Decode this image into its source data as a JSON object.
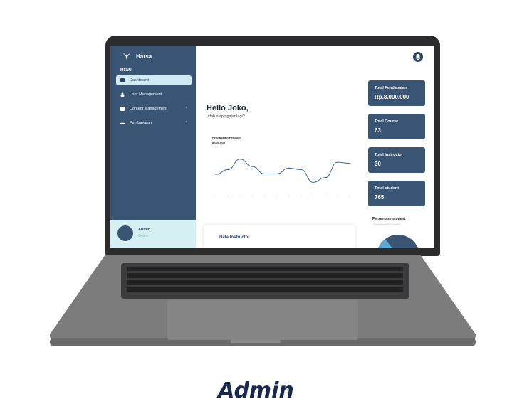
{
  "app": {
    "name": "Harsa"
  },
  "sidebar": {
    "menu_label": "MENU",
    "items": [
      {
        "label": "Dashboard",
        "icon": "dashboard-icon",
        "active": true
      },
      {
        "label": "User Management",
        "icon": "users-icon"
      },
      {
        "label": "Content Management",
        "icon": "content-icon",
        "chevron": "^"
      },
      {
        "label": "Pembayaran",
        "icon": "payment-icon",
        "chevron": "^"
      }
    ],
    "user": {
      "name": "Admin",
      "status": "Online"
    }
  },
  "main": {
    "greeting": "Hello Joko,",
    "subgreeting": "udah siap ngajar lagi?",
    "chart_title": "Pendapatan Perbulan",
    "chart_value": "8.000.000",
    "instructor_card_title": "Data Instructor"
  },
  "stats": [
    {
      "label": "Total  Pendapatan",
      "value": "Rp.8.000.000"
    },
    {
      "label": "Total Course",
      "value": "63"
    },
    {
      "label": "Total  Instructor",
      "value": "30"
    },
    {
      "label": "Total student",
      "value": "765"
    }
  ],
  "pie": {
    "title": "Persentase student",
    "subtitle": "Persentase student perbulan"
  },
  "caption": "Admin",
  "colors": {
    "sidebar": "#3a5574",
    "accent_light": "#cfeaf5",
    "caption": "#18294f"
  },
  "chart_data": {
    "type": "line",
    "title": "Pendapatan Perbulan",
    "x": [
      1,
      2,
      3,
      4,
      5,
      6,
      7,
      8,
      9,
      10,
      11,
      12
    ],
    "values": [
      3.2,
      4.1,
      6.1,
      4.7,
      3.3,
      3.3,
      4.4,
      4.1,
      1.7,
      2.6,
      5.5,
      5.3
    ],
    "grid": false
  }
}
